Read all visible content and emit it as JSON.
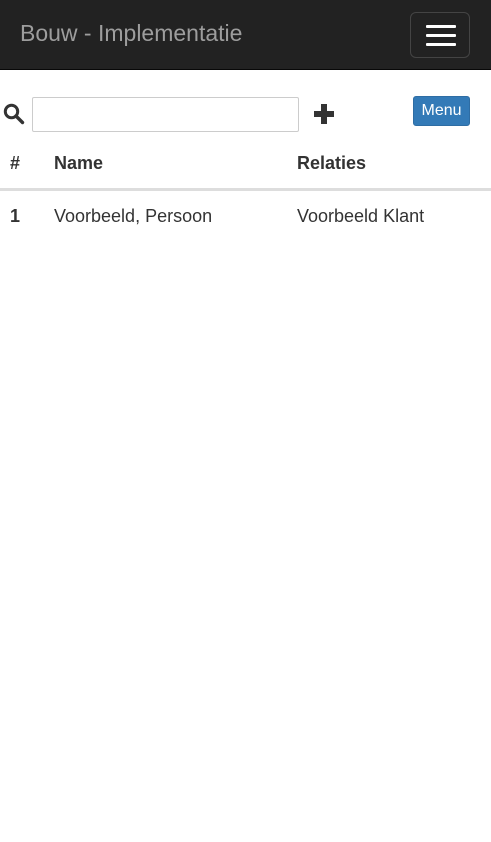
{
  "navbar": {
    "brand": "Bouw - Implementatie",
    "toggle_icon": "hamburger-menu-icon"
  },
  "toolbar": {
    "search_icon": "search-icon",
    "search_value": "",
    "search_placeholder": "",
    "add_icon": "plus-icon",
    "menu_label": "Menu",
    "accent_color": "#337ab7"
  },
  "table": {
    "headers": {
      "num": "#",
      "name": "Name",
      "relations": "Relaties"
    },
    "rows": [
      {
        "num": "1",
        "name": "Voorbeeld, Persoon",
        "relations": "Voorbeeld Klant"
      }
    ]
  }
}
